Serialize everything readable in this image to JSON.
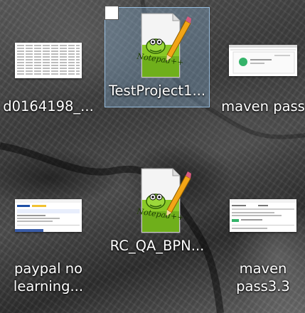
{
  "desktop": {
    "icons": [
      {
        "label": "d0164198_...",
        "icon": "spreadsheet-thumbnail"
      },
      {
        "label": "TestProject1...",
        "icon": "notepadpp-document-icon",
        "selected": true
      },
      {
        "label": "maven pass",
        "icon": "web-screenshot-thumbnail"
      },
      {
        "label": "paypal no",
        "label2": "learning...",
        "icon": "web-screenshot-thumbnail"
      },
      {
        "label": "RC_QA_BPN...",
        "icon": "notepadpp-document-icon"
      },
      {
        "label": "maven",
        "label2": "pass3.3",
        "icon": "web-screenshot-thumbnail"
      }
    ],
    "notepad_logo_text": "Notepad++",
    "colors": {
      "selection": "#99d1ff",
      "notepad_green": "#8ac926",
      "pencil": "#f2a516"
    }
  }
}
